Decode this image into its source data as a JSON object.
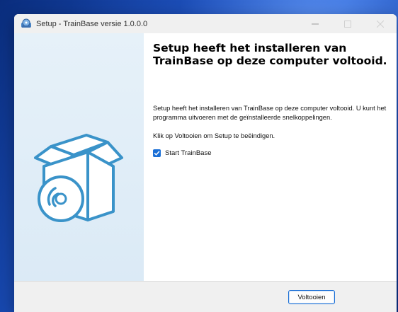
{
  "window": {
    "title": "Setup - TrainBase versie 1.0.0.0",
    "controls": {
      "minimize_icon": "minimize-icon",
      "maximize_icon": "maximize-icon",
      "close_icon": "close-icon"
    }
  },
  "content": {
    "heading": "Setup heeft het installeren van TrainBase op deze computer voltooid.",
    "paragraph1": "Setup heeft het installeren van TrainBase op deze computer voltooid. U kunt het programma uitvoeren met de geïnstalleerde snelkoppelingen.",
    "paragraph2": "Klik op Voltooien om Setup te beëindigen.",
    "checkbox": {
      "label": "Start TrainBase",
      "checked": true
    }
  },
  "footer": {
    "finish_label": "Voltooien"
  },
  "colors": {
    "accent": "#1a6fd6",
    "sidebar": "#e3eff8",
    "box_stroke": "#3a93c9"
  }
}
